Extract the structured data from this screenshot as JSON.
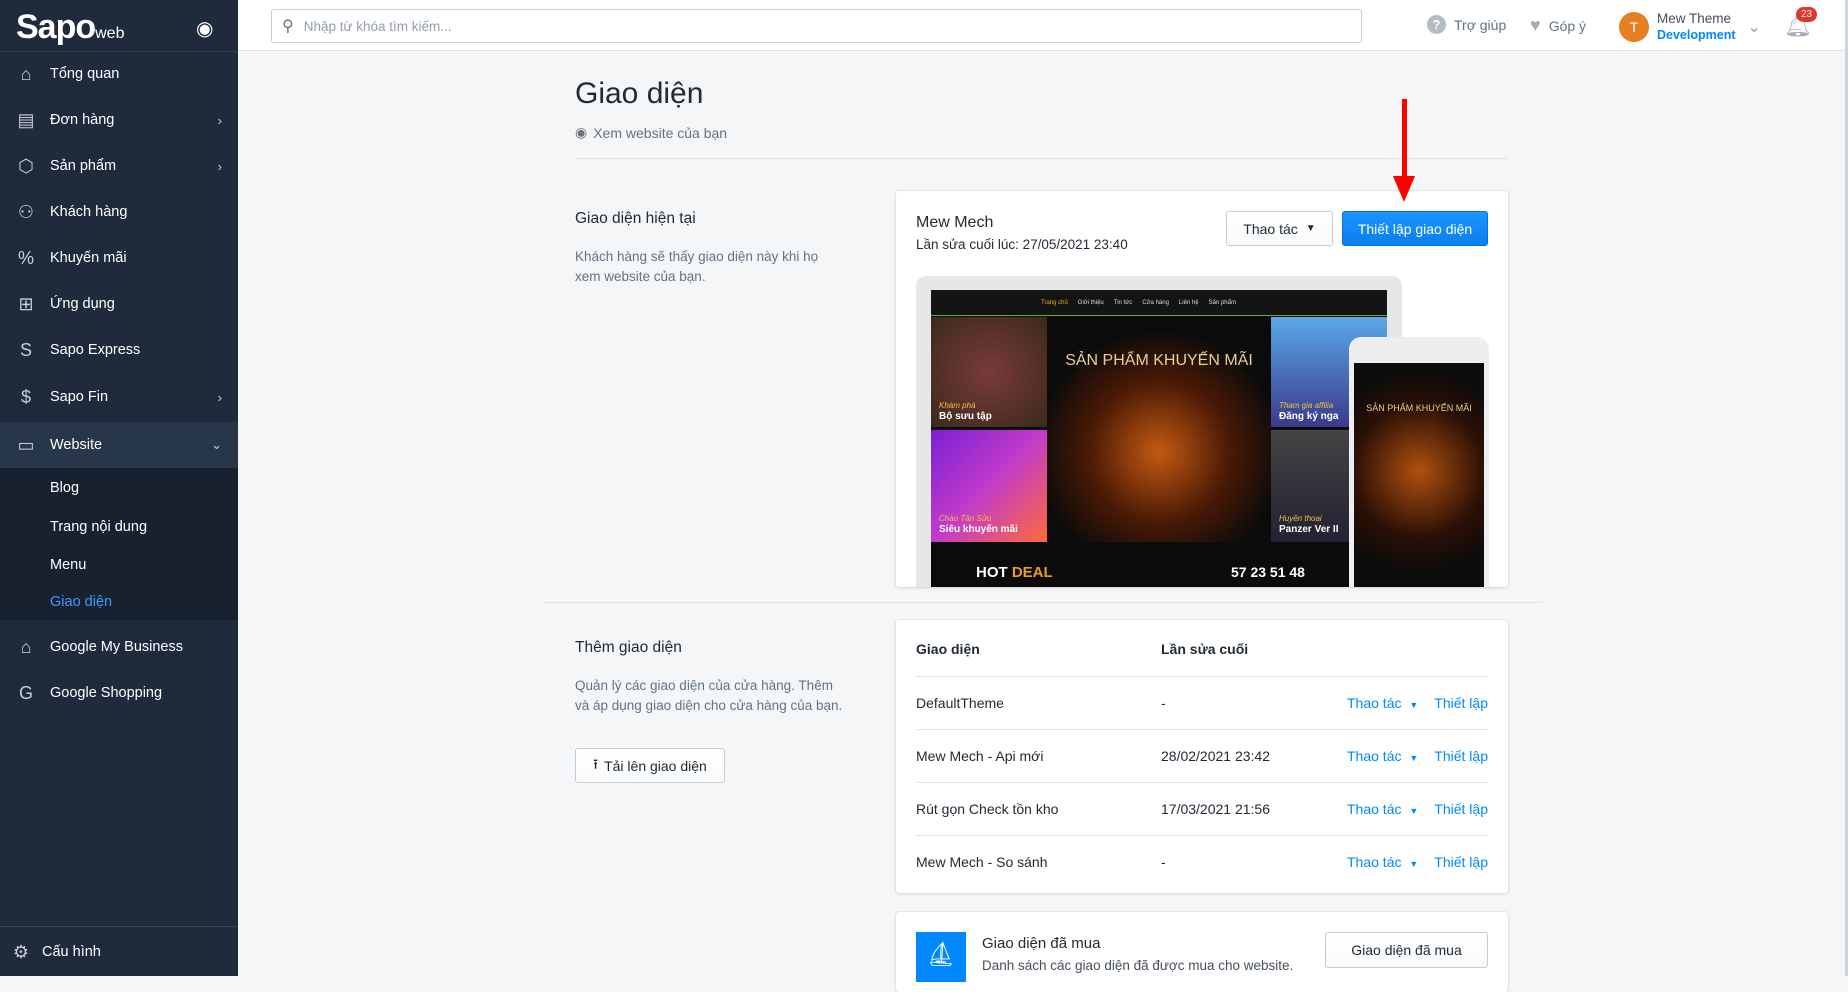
{
  "sidebar": {
    "logo": "Sapo",
    "logo_suffix": "web",
    "items": [
      {
        "label": "Tổng quan",
        "icon": "home-icon"
      },
      {
        "label": "Đơn hàng",
        "icon": "order-icon"
      },
      {
        "label": "Sản phẩm",
        "icon": "box-icon"
      },
      {
        "label": "Khách hàng",
        "icon": "user-icon"
      },
      {
        "label": "Khuyến mãi",
        "icon": "discount-icon"
      },
      {
        "label": "Ứng dụng",
        "icon": "apps-icon"
      },
      {
        "label": "Sapo Express",
        "icon": "express-icon"
      },
      {
        "label": "Sapo Fin",
        "icon": "money-bag-icon"
      },
      {
        "label": "Website",
        "icon": "store-icon"
      }
    ],
    "website_sub": [
      "Blog",
      "Trang nội dung",
      "Menu",
      "Giao diện"
    ],
    "items2": [
      {
        "label": "Google My Business",
        "icon": "storefront-icon"
      },
      {
        "label": "Google Shopping",
        "icon": "google-icon"
      }
    ],
    "settings": "Cấu hình"
  },
  "topbar": {
    "search_placeholder": "Nhập từ khóa tìm kiếm...",
    "help": "Trợ giúp",
    "feedback": "Góp ý",
    "avatar_letter": "T",
    "user_name": "Mew Theme",
    "user_role": "Development",
    "notifications": "23"
  },
  "page": {
    "title": "Giao diện",
    "view_site": "Xem website của bạn",
    "current": {
      "heading": "Giao diện hiện tại",
      "desc": "Khách hàng sẽ thấy giao diện này khi họ xem website của bạn.",
      "theme_name": "Mew Mech",
      "last_edit": "Lần sửa cuối lúc: 27/05/2021 23:40",
      "actions": "Thao tác",
      "customize": "Thiết lập giao diện",
      "preview": {
        "menu": [
          "Trang chủ",
          "Giới thiệu",
          "Tin tức",
          "Cửa hàng",
          "Liên hệ",
          "Sản phẩm"
        ],
        "headline": "SẢN PHẨM KHUYẾN MÃI",
        "tile1a": "Khám phá",
        "tile1b": "Bộ sưu tập",
        "tile2a": "Chào Tân Sửu",
        "tile2b": "Siêu khuyến mãi",
        "tile3a": "Tham gia affilia",
        "tile3b": "Đăng ký nga",
        "tile4a": "Huyền thoại",
        "tile4b": "Panzer Ver II",
        "hot": "HOT",
        "deal": "DEAL",
        "countdown": "57 23 51 48"
      }
    },
    "add": {
      "heading": "Thêm giao diện",
      "desc": "Quản lý các giao diện của cửa hàng. Thêm và áp dụng giao diện cho cửa hàng của bạn.",
      "upload": "Tải lên giao diện"
    },
    "table": {
      "col_theme": "Giao diện",
      "col_edit": "Lần sửa cuối",
      "action": "Thao tác",
      "setup": "Thiết lập",
      "rows": [
        {
          "name": "DefaultTheme",
          "edited": "-"
        },
        {
          "name": "Mew Mech - Api mới",
          "edited": "28/02/2021 23:42"
        },
        {
          "name": "Rút gọn Check tồn kho",
          "edited": "17/03/2021 21:56"
        },
        {
          "name": "Mew Mech - So sánh",
          "edited": "-"
        }
      ]
    },
    "purchased": {
      "title": "Giao diện đã mua",
      "desc": "Danh sách các giao diện đã được mua cho website.",
      "button": "Giao diện đã mua"
    }
  },
  "colors": {
    "accent": "#0088ff",
    "sidebar": "#1f2a3c",
    "avatar": "#e67e22",
    "badge": "#e4342c",
    "arrow": "#ff0000"
  }
}
